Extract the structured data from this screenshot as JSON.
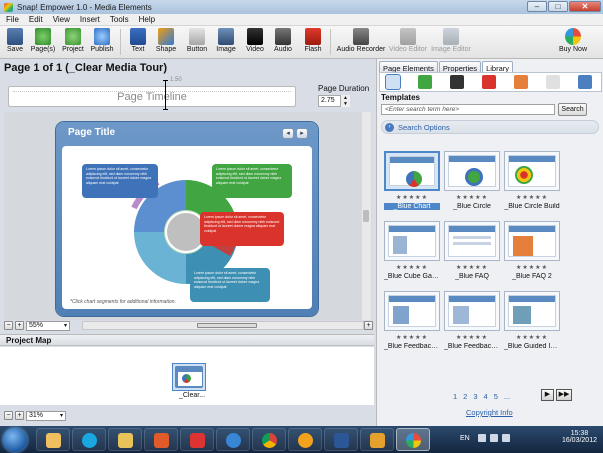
{
  "window": {
    "title": "Snap! Empower 1.0 - Media Elements",
    "min": "–",
    "max": "□",
    "close": "✕"
  },
  "menu": [
    "File",
    "Edit",
    "View",
    "Insert",
    "Tools",
    "Help"
  ],
  "toolbar": {
    "save": "Save",
    "pages": "Page(s)",
    "project": "Project",
    "publish": "Publish",
    "text": "Text",
    "shape": "Shape",
    "button": "Button",
    "image": "Image",
    "video": "Video",
    "audio": "Audio",
    "flash": "Flash",
    "audio_recorder": "Audio Recorder",
    "video_editor": "Video Editor",
    "image_editor": "Image Editor",
    "buy_now": "Buy Now"
  },
  "editor": {
    "heading": "Page 1 of 1 (_Clear Media Tour)",
    "timeline_label": "Page Timeline",
    "timeline_time": "1.50",
    "page_duration_label": "Page Duration",
    "page_duration_value": "2.75",
    "zoom": "55%"
  },
  "slide": {
    "title": "Page Title",
    "callout_text": "Lorem ipsum dolor sit amet, consectetur adipiscing elit, sed diam nonummy nibh euismod tincidunt ut laoreet dolore magna aliquam erat volutpat",
    "footnote": "*Click chart segments for additional information."
  },
  "project_map": {
    "heading": "Project Map",
    "thumb_label": "_Clear...",
    "zoom": "31%"
  },
  "panel": {
    "tabs": [
      "Page Elements",
      "Properties",
      "Library"
    ],
    "templates_heading": "Templates",
    "search_placeholder": "<Enter search term here>",
    "search_button": "Search",
    "search_options": "Search Options",
    "stars": "★★★★★",
    "templates": [
      "_Blue Chart",
      "_Blue Circle",
      "_Blue Circle Build",
      "_Blue Cube Gall...",
      "_Blue FAQ",
      "_Blue FAQ 2",
      "_Blue Feedback ...",
      "_Blue Feedback ...",
      "_Blue Guided Im..."
    ],
    "pages": [
      "1",
      "2",
      "3",
      "4",
      "5",
      "..."
    ],
    "next": "▶",
    "last": "▶▶",
    "copyright": "Copyright Info"
  },
  "taskbar": {
    "lang": "EN",
    "time": "15:38",
    "date": "16/03/2012"
  },
  "colors": {
    "accent": "#4d86c9",
    "slide_blue": "#5a8ac2",
    "green": "#41a542",
    "red": "#d9332b"
  }
}
